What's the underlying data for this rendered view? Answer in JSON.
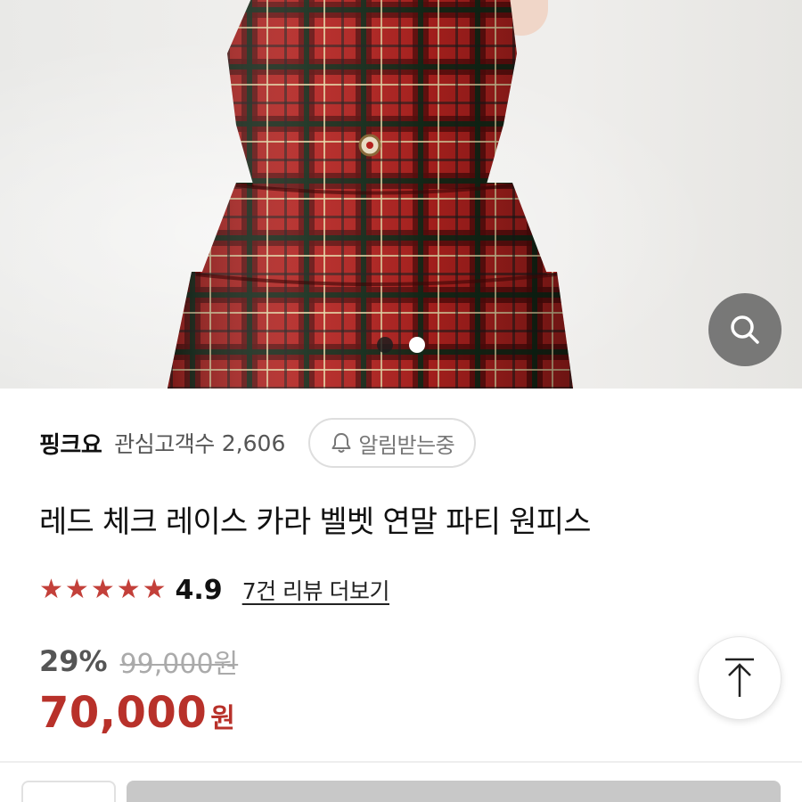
{
  "product_image": {
    "alt": "",
    "carousel": {
      "total": 2,
      "active_index": 1
    },
    "zoom_icon": "search-icon"
  },
  "store": {
    "name": "핑크요",
    "follower_label": "관심고객수",
    "follower_count": "2,606",
    "alarm_label": "알림받는중",
    "alarm_icon": "bell-icon"
  },
  "product": {
    "title": "레드 체크 레이스 카라 벨벳 연말 파티 원피스",
    "rating": "4.9",
    "star_count": 5,
    "star_color": "#c3403a",
    "review_link": "7건 리뷰 더보기"
  },
  "pricing": {
    "discount_rate": "29%",
    "original_price": "99,000원",
    "sale_price": "70,000",
    "sale_unit": "원",
    "sale_color": "#b8312a"
  },
  "scroll_top_icon": "arrow-up-icon"
}
